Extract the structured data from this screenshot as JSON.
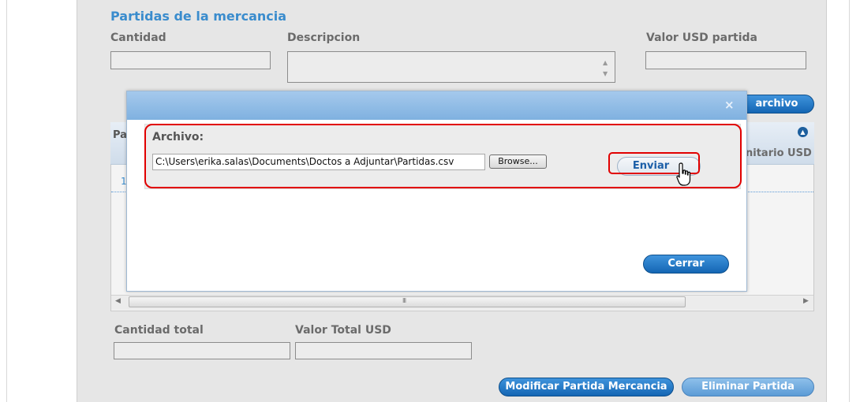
{
  "section": {
    "title": "Partidas de la mercancia"
  },
  "form": {
    "cantidad_label": "Cantidad",
    "descripcion_label": "Descripcion",
    "valor_label": "Valor USD partida"
  },
  "toolbar": {
    "archivo_button": "archivo"
  },
  "grid": {
    "header_partial": "Pa",
    "unit_col_partial": "nitario USD",
    "row_number": "1"
  },
  "modal": {
    "close_icon": "×",
    "archivo_label": "Archivo:",
    "file_path": "C:\\Users\\erika.salas\\Documents\\Doctos a Adjuntar\\Partidas.csv",
    "browse_label": "Browse...",
    "enviar_label": "Enviar",
    "cerrar_label": "Cerrar"
  },
  "totals": {
    "cantidad_total_label": "Cantidad total",
    "valor_total_label": "Valor Total USD"
  },
  "actions": {
    "modificar_label": "Modificar Partida Mercancia",
    "eliminar_label": "Eliminar Partida"
  },
  "scrollbar": {
    "thumb_grip": "III"
  },
  "colors": {
    "accent": "#1466b4",
    "title": "#3a8ccd",
    "highlight": "#e10000"
  }
}
